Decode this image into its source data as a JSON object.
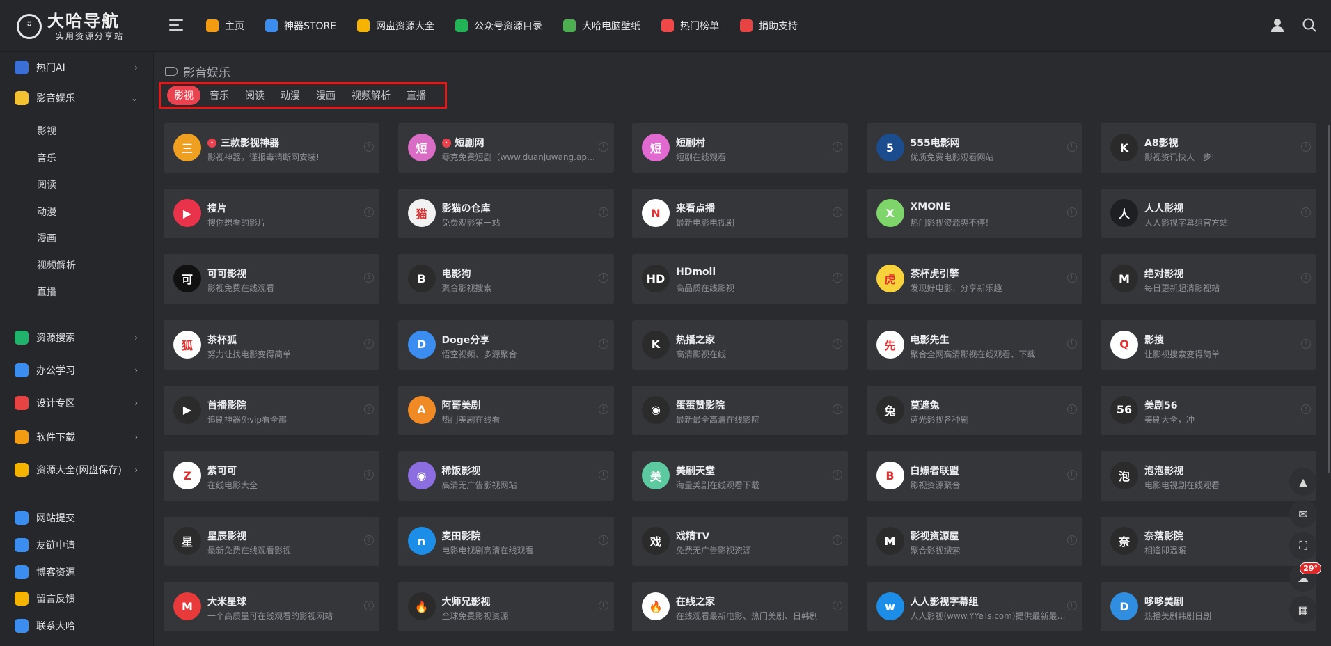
{
  "brand": {
    "title": "大哈导航",
    "subtitle": "实用资源分享站"
  },
  "nav": [
    {
      "label": "主页",
      "icon": "home-icon",
      "color": "#f39c12"
    },
    {
      "label": "神器STORE",
      "icon": "paper-plane-icon",
      "color": "#3b8df0"
    },
    {
      "label": "网盘资源大全",
      "icon": "cloud-download-icon",
      "color": "#f5b400"
    },
    {
      "label": "公众号资源目录",
      "icon": "wechat-icon",
      "color": "#21b356"
    },
    {
      "label": "大哈电脑壁纸",
      "icon": "image-icon",
      "color": "#4caf50"
    },
    {
      "label": "热门榜单",
      "icon": "fire-icon",
      "color": "#f04848"
    },
    {
      "label": "捐助支持",
      "icon": "gift-icon",
      "color": "#e84343"
    }
  ],
  "sidebar": {
    "groups": [
      {
        "label": "热门AI",
        "icon": "ai-icon",
        "color": "#3b6fd8",
        "arrow": "›"
      },
      {
        "label": "影音娱乐",
        "icon": "media-icon",
        "color": "#f2c230",
        "arrow": "⌄"
      },
      {
        "label": "资源搜索",
        "icon": "search-icon",
        "color": "#1fb36b",
        "arrow": "›"
      },
      {
        "label": "办公学习",
        "icon": "briefcase-icon",
        "color": "#3b8df0",
        "arrow": "›"
      },
      {
        "label": "设计专区",
        "icon": "design-icon",
        "color": "#e84343",
        "arrow": "›"
      },
      {
        "label": "软件下载",
        "icon": "download-icon",
        "color": "#f39c12",
        "arrow": "›"
      },
      {
        "label": "资源大全(网盘保存)",
        "icon": "cloud-download-icon",
        "color": "#f5b400",
        "arrow": "›"
      }
    ],
    "subs": [
      "影视",
      "音乐",
      "阅读",
      "动漫",
      "漫画",
      "视频解析",
      "直播"
    ],
    "footer": [
      {
        "label": "网站提交",
        "icon": "send-icon",
        "color": "#3b8df0"
      },
      {
        "label": "友链申请",
        "icon": "users-icon",
        "color": "#3b8df0"
      },
      {
        "label": "博客资源",
        "icon": "blog-icon",
        "color": "#3b8df0"
      },
      {
        "label": "留言反馈",
        "icon": "edit-icon",
        "color": "#f5b400"
      },
      {
        "label": "联系大哈",
        "icon": "contact-icon",
        "color": "#3b8df0"
      }
    ]
  },
  "section": {
    "title": "影音娱乐",
    "tabs": [
      "影视",
      "音乐",
      "阅读",
      "动漫",
      "漫画",
      "视频解析",
      "直播"
    ],
    "active_tab": 0
  },
  "cards": [
    {
      "title": "三款影视神器",
      "desc": "影视神器，谨报毒请断网安装!",
      "bg": "#f0a020",
      "glyph": "三",
      "hot": true
    },
    {
      "title": "短剧网",
      "desc": "零克免费短剧（www.duanjuwang.app）...",
      "bg": "#d96cc4",
      "glyph": "短",
      "hot": true
    },
    {
      "title": "短剧村",
      "desc": "短剧在线观看",
      "bg": "#e06ad0",
      "glyph": "短",
      "hot": false
    },
    {
      "title": "555电影网",
      "desc": "优质免费电影观看网站",
      "bg": "#1b4d8e",
      "glyph": "5",
      "hot": false
    },
    {
      "title": "A8影视",
      "desc": "影视资讯快人一步!",
      "bg": "#2a2a2a",
      "glyph": "K",
      "hot": false
    },
    {
      "title": "搜片",
      "desc": "搜你想看的影片",
      "bg": "#e8334a",
      "glyph": "▶",
      "hot": false
    },
    {
      "title": "影猫の仓库",
      "desc": "免费观影第一站",
      "bg": "#f2f2f2",
      "glyph": "猫",
      "hot": false
    },
    {
      "title": "来看点播",
      "desc": "最新电影电视剧",
      "bg": "#ffffff",
      "glyph": "N",
      "hot": false
    },
    {
      "title": "XMONE",
      "desc": "热门影视资源爽不停!",
      "bg": "#7ed66a",
      "glyph": "X",
      "hot": false
    },
    {
      "title": "人人影视",
      "desc": "人人影视字幕组官方站",
      "bg": "#1e1f22",
      "glyph": "人",
      "hot": false
    },
    {
      "title": "可可影视",
      "desc": "影视免费在线观看",
      "bg": "#111111",
      "glyph": "可",
      "hot": false
    },
    {
      "title": "电影狗",
      "desc": "聚合影视搜索",
      "bg": "#2b2b2b",
      "glyph": "B",
      "hot": false
    },
    {
      "title": "HDmoli",
      "desc": "高品质在线影视",
      "bg": "#2b2b2b",
      "glyph": "HD",
      "hot": false
    },
    {
      "title": "茶杯虎引擎",
      "desc": "发现好电影，分享新乐趣",
      "bg": "#f7d23a",
      "glyph": "虎",
      "hot": false
    },
    {
      "title": "绝对影视",
      "desc": "每日更新超清影视站",
      "bg": "#2b2b2b",
      "glyph": "M",
      "hot": false
    },
    {
      "title": "茶杯狐",
      "desc": "努力让找电影变得简单",
      "bg": "#ffffff",
      "glyph": "狐",
      "hot": false
    },
    {
      "title": "Doge分享",
      "desc": "悟空视频、多源聚合",
      "bg": "#3b8df0",
      "glyph": "D",
      "hot": false
    },
    {
      "title": "热播之家",
      "desc": "高清影视在线",
      "bg": "#2b2b2b",
      "glyph": "K",
      "hot": false
    },
    {
      "title": "电影先生",
      "desc": "聚合全网高清影视在线观看、下载",
      "bg": "#ffffff",
      "glyph": "先",
      "hot": false
    },
    {
      "title": "影搜",
      "desc": "让影视搜索变得简单",
      "bg": "#ffffff",
      "glyph": "Q",
      "hot": false
    },
    {
      "title": "首播影院",
      "desc": "追剧神器免vip看全部",
      "bg": "#2b2b2b",
      "glyph": "▶",
      "hot": false
    },
    {
      "title": "阿哥美剧",
      "desc": "热门美剧在线看",
      "bg": "#f08a24",
      "glyph": "A",
      "hot": false
    },
    {
      "title": "蛋蛋赞影院",
      "desc": "最新最全高清在线影院",
      "bg": "#2b2b2b",
      "glyph": "◉",
      "hot": false
    },
    {
      "title": "莫遮兔",
      "desc": "蓝光影视各种剧",
      "bg": "#2b2b2b",
      "glyph": "兔",
      "hot": false
    },
    {
      "title": "美剧56",
      "desc": "美剧大全，冲",
      "bg": "#2b2b2b",
      "glyph": "56",
      "hot": false
    },
    {
      "title": "紫可可",
      "desc": "在线电影大全",
      "bg": "#ffffff",
      "glyph": "Z",
      "hot": false
    },
    {
      "title": "稀饭影视",
      "desc": "高清无广告影视网站",
      "bg": "#8c6ee0",
      "glyph": "◉",
      "hot": false
    },
    {
      "title": "美剧天堂",
      "desc": "海量美剧在线观看下载",
      "bg": "#5cc9a0",
      "glyph": "美",
      "hot": false
    },
    {
      "title": "白嫖者联盟",
      "desc": "影视资源聚合",
      "bg": "#ffffff",
      "glyph": "B",
      "hot": false
    },
    {
      "title": "泡泡影视",
      "desc": "电影电视剧在线观看",
      "bg": "#2b2b2b",
      "glyph": "泡",
      "hot": false
    },
    {
      "title": "星辰影视",
      "desc": "最新免费在线观看影视",
      "bg": "#2b2b2b",
      "glyph": "星",
      "hot": false
    },
    {
      "title": "麦田影院",
      "desc": "电影电视剧高清在线观看",
      "bg": "#1d8ee8",
      "glyph": "n",
      "hot": false
    },
    {
      "title": "戏精TV",
      "desc": "免费无广告影视资源",
      "bg": "#2b2b2b",
      "glyph": "戏",
      "hot": false
    },
    {
      "title": "影视资源屋",
      "desc": "聚合影视搜索",
      "bg": "#2b2b2b",
      "glyph": "M",
      "hot": false
    },
    {
      "title": "奈落影院",
      "desc": "相逢即温暖",
      "bg": "#2b2b2b",
      "glyph": "奈",
      "hot": false
    },
    {
      "title": "大米星球",
      "desc": "一个高质量可在线观看的影视网站",
      "bg": "#e83a3a",
      "glyph": "M",
      "hot": false
    },
    {
      "title": "大师兄影视",
      "desc": "全球免费影视资源",
      "bg": "#2b2b2b",
      "glyph": "🔥",
      "hot": false
    },
    {
      "title": "在线之家",
      "desc": "在线观看最新电影、热门美剧、日韩剧",
      "bg": "#ffffff",
      "glyph": "🔥",
      "hot": false
    },
    {
      "title": "人人影视字幕组",
      "desc": "人人影视(www.YYeTs.com)提供最新最全...",
      "bg": "#1d8ee8",
      "glyph": "w",
      "hot": false
    },
    {
      "title": "哆哆美剧",
      "desc": "热播美剧韩剧日剧",
      "bg": "#2f8ee0",
      "glyph": "D",
      "hot": false
    }
  ],
  "float": {
    "temp": "29°"
  }
}
